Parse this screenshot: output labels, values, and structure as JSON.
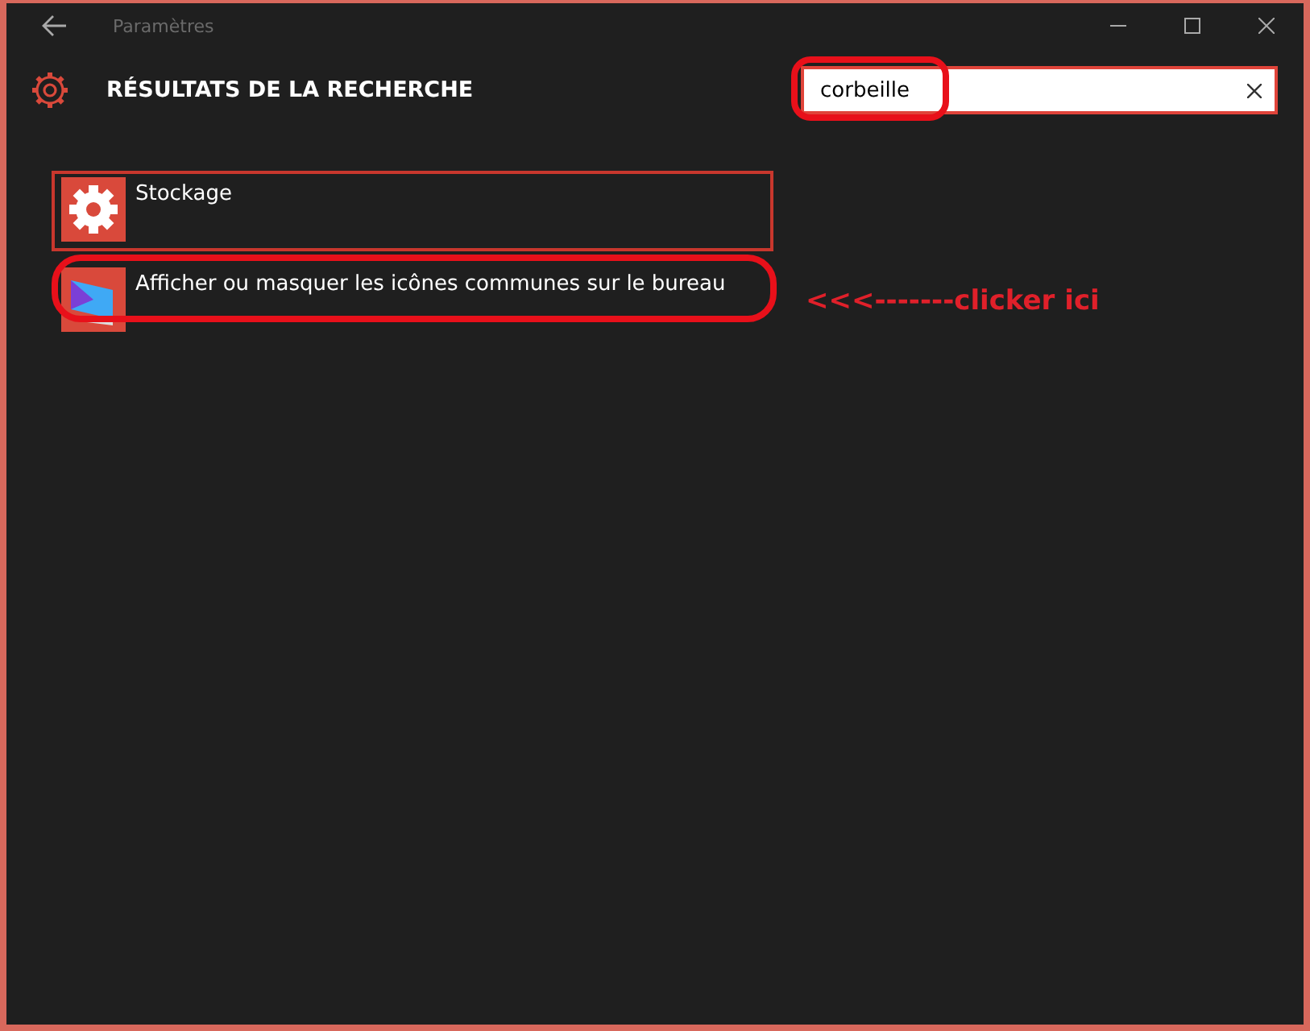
{
  "window": {
    "title": "Paramètres"
  },
  "header": {
    "title": "RÉSULTATS DE LA RECHERCHE"
  },
  "search": {
    "value": "corbeille",
    "circled": true
  },
  "results": [
    {
      "label": "Stockage",
      "kind": "gear",
      "selected": true,
      "circled": false
    },
    {
      "label": "Afficher ou masquer les icônes communes sur le bureau",
      "kind": "desktop",
      "selected": false,
      "circled": true,
      "note": "<<<-------clicker ici"
    }
  ]
}
